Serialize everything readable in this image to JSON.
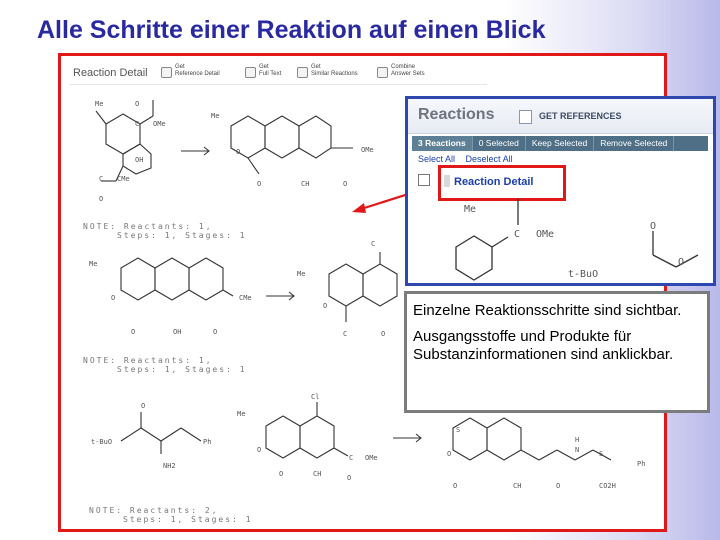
{
  "slide": {
    "title": "Alle Schritte einer Reaktion auf einen Blick"
  },
  "screenshot": {
    "toolbar": {
      "title": "Reaction Detail",
      "buttons": [
        {
          "line1": "Get",
          "line2": "Reference Detail",
          "icon": "document-icon"
        },
        {
          "line1": "Get",
          "line2": "Full Text",
          "icon": "fulltext-icon"
        },
        {
          "line1": "Get",
          "line2": "Similar Reactions",
          "icon": "similar-reactions-icon"
        },
        {
          "line1": "Combine",
          "line2": "Answer Sets",
          "icon": "combine-icon"
        }
      ]
    },
    "notes": [
      {
        "line1": "NOTE: Reactants: 1,",
        "line2": "Steps: 1, Stages: 1"
      },
      {
        "line1": "NOTE: Reactants: 1,",
        "line2": "Steps: 1, Stages: 1"
      },
      {
        "line1": "NOTE: Reactants: 2,",
        "line2": "Steps: 1, Stages: 1"
      }
    ],
    "chem_labels": {
      "me": "Me",
      "ome": "OMe",
      "oh": "OH",
      "o": "O",
      "cme": "CMe",
      "ch": "CH",
      "cl": "Cl",
      "tbuo": "t-BuO",
      "ph": "Ph",
      "nh2": "NH2",
      "co2h": "CO2H",
      "h": "H",
      "n": "N",
      "c": "C",
      "s": "S"
    }
  },
  "inset": {
    "title": "Reactions",
    "get_references": "GET REFERENCES",
    "tabs": [
      "3 Reactions",
      "0 Selected",
      "Keep Selected",
      "Remove Selected"
    ],
    "select_all": "Select All",
    "deselect_all": "Deselect All",
    "reaction_detail": "Reaction Detail",
    "chem": {
      "me": "Me",
      "ome": "OMe",
      "c": "C",
      "o": "O",
      "tbuo": "t-BuO"
    }
  },
  "callout": {
    "line1": "Einzelne Reaktionsschritte sind sichtbar.",
    "line2": "Ausgangsstoffe und Produkte für Substanzinformationen sind anklickbar."
  },
  "colors": {
    "title": "#2a2aa0",
    "frame": "#e01818",
    "inset_border": "#2f48b0"
  }
}
